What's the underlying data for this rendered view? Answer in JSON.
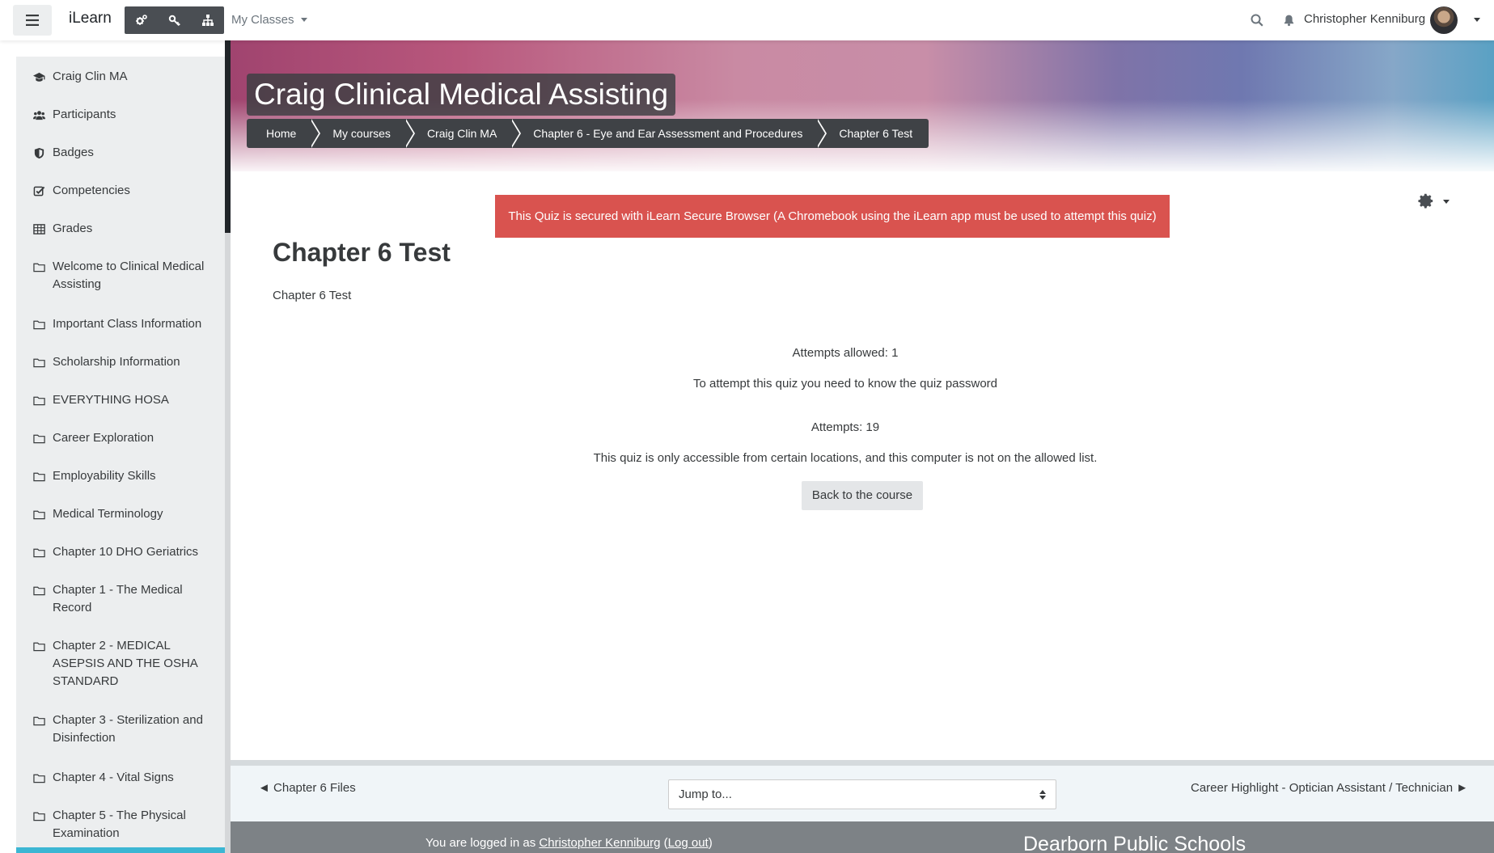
{
  "navbar": {
    "brand": "iLearn",
    "my_classes": "My Classes",
    "user_name": "Christopher Kenniburg",
    "icons": [
      "cogs-icon",
      "key-icon",
      "sitemap-icon"
    ]
  },
  "sidebar": {
    "items": [
      {
        "label": "Craig Clin MA",
        "icon": "graduation-cap-icon"
      },
      {
        "label": "Participants",
        "icon": "users-icon"
      },
      {
        "label": "Badges",
        "icon": "shield-icon"
      },
      {
        "label": "Competencies",
        "icon": "check-square-icon"
      },
      {
        "label": "Grades",
        "icon": "table-icon"
      },
      {
        "label": "Welcome to Clinical Medical Assisting",
        "icon": "folder-icon"
      },
      {
        "label": "Important Class Information",
        "icon": "folder-icon"
      },
      {
        "label": "Scholarship Information",
        "icon": "folder-icon"
      },
      {
        "label": "EVERYTHING HOSA",
        "icon": "folder-icon"
      },
      {
        "label": "Career Exploration",
        "icon": "folder-icon"
      },
      {
        "label": "Employability Skills",
        "icon": "folder-icon"
      },
      {
        "label": "Medical Terminology",
        "icon": "folder-icon"
      },
      {
        "label": "Chapter 10 DHO Geriatrics",
        "icon": "folder-icon"
      },
      {
        "label": "Chapter 1 - The Medical Record",
        "icon": "folder-icon"
      },
      {
        "label": "Chapter 2 - MEDICAL ASEPSIS AND THE OSHA STANDARD",
        "icon": "folder-icon"
      },
      {
        "label": "Chapter 3 - Sterilization and Disinfection",
        "icon": "folder-icon"
      },
      {
        "label": "Chapter 4 - Vital Signs",
        "icon": "folder-icon"
      },
      {
        "label": "Chapter 5 - The Physical Examination",
        "icon": "folder-icon"
      }
    ]
  },
  "header": {
    "course_title": "Craig Clinical Medical Assisting",
    "breadcrumbs": [
      "Home",
      "My courses",
      "Craig Clin MA",
      "Chapter 6 - Eye and Ear Assessment and Procedures",
      "Chapter 6 Test"
    ]
  },
  "alert": {
    "text": "This Quiz is secured with iLearn Secure Browser (A Chromebook using the iLearn app must be used to attempt this quiz)",
    "color": "#d9534f"
  },
  "main": {
    "title": "Chapter 6 Test",
    "intro": "Chapter 6 Test",
    "attempts_allowed": "Attempts allowed: 1",
    "password_notice": "To attempt this quiz you need to know the quiz password",
    "attempts": "Attempts: 19",
    "location_notice": "This quiz is only accessible from certain locations, and this computer is not on the allowed list.",
    "back_button": "Back to the course"
  },
  "activity_nav": {
    "prev": "◄ Chapter 6 Files",
    "jump_placeholder": "Jump to...",
    "next": "Career Highlight - Optician Assistant / Technician ►"
  },
  "footer": {
    "logged_in_prefix": "You are logged in as ",
    "user_link": "Christopher Kenniburg",
    "logout_open": " (",
    "logout_link": "Log out",
    "logout_close": ")",
    "org_name": "Dearborn Public Schools"
  },
  "colors": {
    "accent": "#3cb6d3",
    "navbar_dark": "#4a4e53",
    "footer": "#7d8286"
  }
}
